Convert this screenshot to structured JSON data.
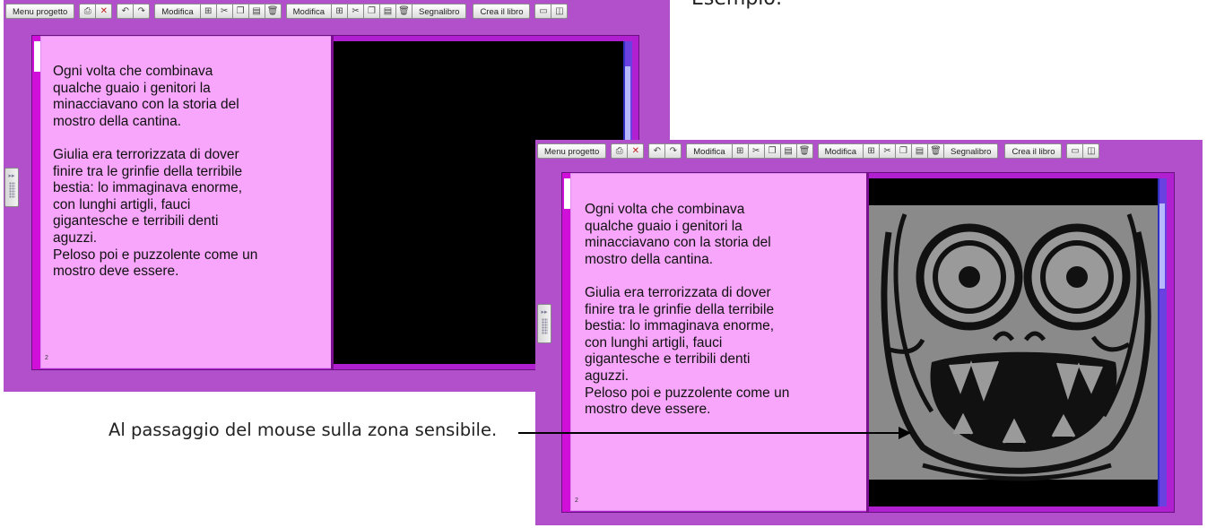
{
  "captions": {
    "top": "Esempio:",
    "bottom": "Al passaggio del mouse sulla zona sensibile."
  },
  "toolbar": {
    "menu_label": "Menu progetto",
    "edit_label_1": "Modifica",
    "edit_label_2": "Modifica",
    "bookmark_label": "Segnalibro",
    "create_book_label": "Crea il libro",
    "icons": [
      "print-icon",
      "no-audio-icon",
      "undo-icon",
      "redo-icon",
      "add-icon",
      "cut-icon",
      "copy-icon",
      "paste-icon",
      "trash-icon",
      "single-view-icon",
      "double-view-icon"
    ]
  },
  "book": {
    "page_text": "Ogni volta che combinava\nqualche guaio i genitori la\nminacciavano con la storia del\nmostro della cantina.\n\nGiulia era terrorizzata di dover\nfinire tra le grinfie della terribile\nbestia: lo immaginava enorme,\ncon lunghi artigli, fauci\ngigantesche e terribili denti\naguzzi.\nPeloso poi e puzzolente come un\nmostro deve essere.",
    "page_number": "2"
  },
  "colors": {
    "app_bg": "#b24fca",
    "page_bg": "#f7a6fb",
    "book_frame": "#b020d0",
    "image_bg": "#000000",
    "monster_bg": "#8a8a8a"
  }
}
